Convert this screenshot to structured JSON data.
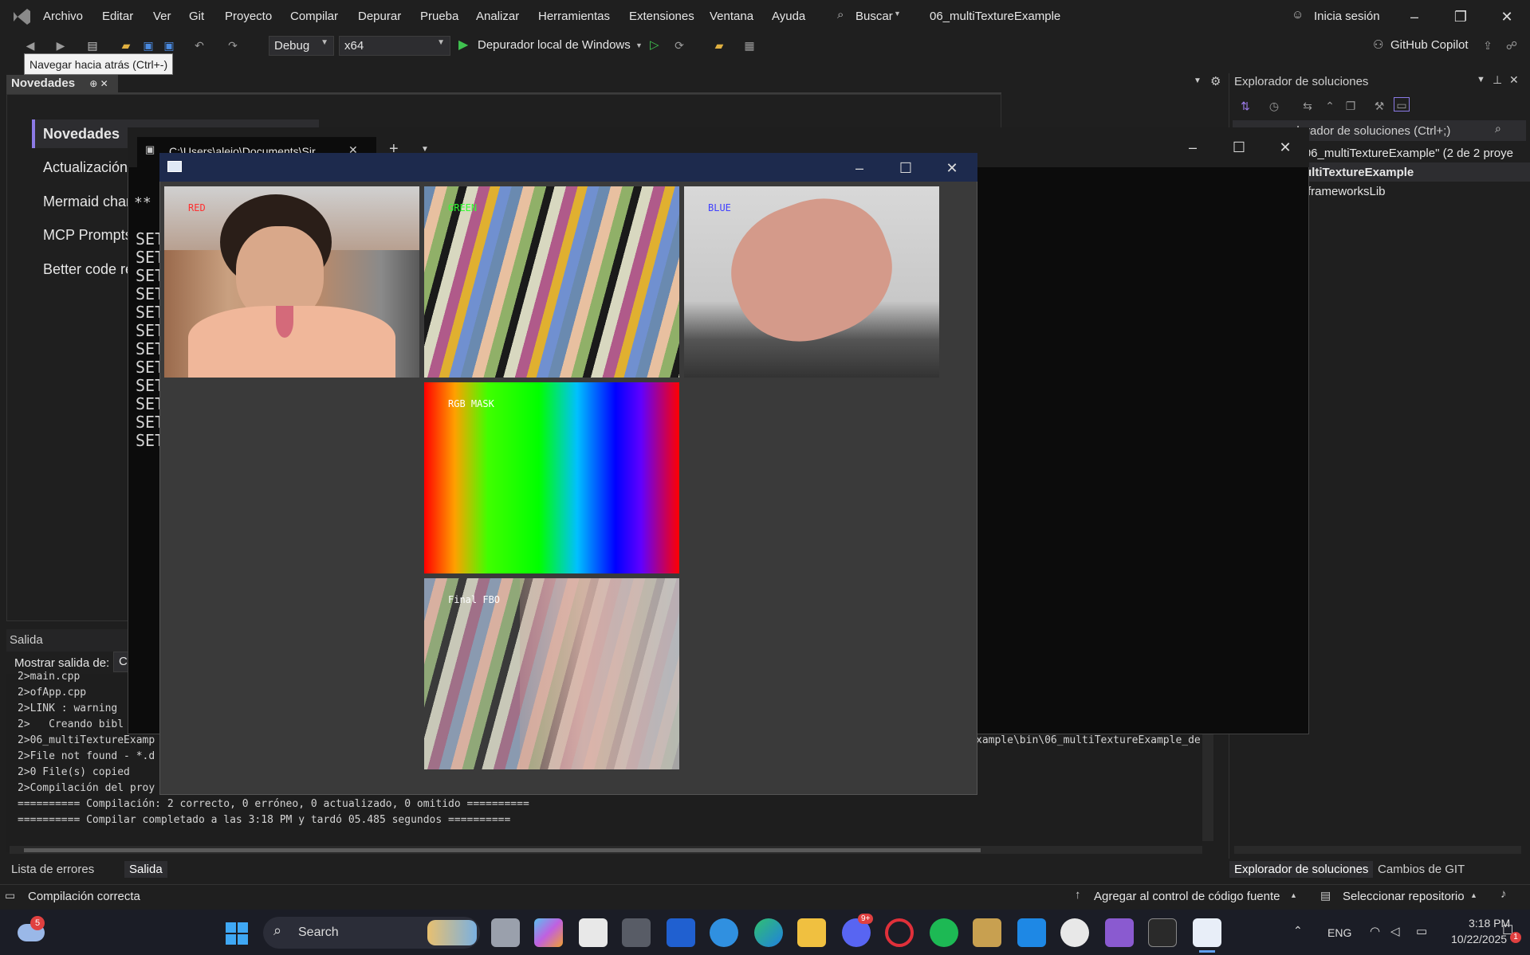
{
  "menubar": {
    "items": [
      "Archivo",
      "Editar",
      "Ver",
      "Git",
      "Proyecto",
      "Compilar",
      "Depurar",
      "Prueba",
      "Analizar",
      "Herramientas",
      "Extensiones",
      "Ventana",
      "Ayuda"
    ],
    "search_label": "Buscar",
    "solution_title": "06_multiTextureExample",
    "signin_label": "Inicia sesión"
  },
  "toolbar": {
    "config": "Debug",
    "platform": "x64",
    "run_label": "Depurador local de Windows",
    "copilot_label": "GitHub Copilot",
    "tooltip": "Navegar hacia atrás (Ctrl+-)"
  },
  "doc": {
    "tab_label": "Novedades",
    "news_items": [
      "Novedades",
      "Actualización",
      "Mermaid char",
      "MCP Prompts",
      "Better code re"
    ]
  },
  "output": {
    "title": "Salida",
    "show_from_label": "Mostrar salida de:",
    "show_from_value": "C",
    "lines": [
      "2>main.cpp",
      "2>ofApp.cpp",
      "2>LINK : warning",
      "2>   Creando bibl",
      "2>06_multiTextureExamp",
      "2>File not found - *.d",
      "2>0 File(s) copied",
      "2>Compilación del proy",
      "========== Compilación: 2 correcto, 0 erróneo, 0 actualizado, 0 omitido ==========",
      "========== Compilar completado a las 3:18 PM y tardó 05.485 segundos =========="
    ],
    "right_path": "xample\\bin\\06_multiTextureExample_de"
  },
  "bottom_tabs": [
    "Lista de errores",
    "Salida"
  ],
  "solution_explorer": {
    "title": "Explorador de soluciones",
    "search_placeholder": "plorador de soluciones (Ctrl+;)",
    "solution_line": "n \"06_multiTextureExample\"  (2 de 2 proye",
    "project": "ultiTextureExample",
    "lib": "frameworksLib",
    "tabs": [
      "Explorador de soluciones",
      "Cambios de GIT"
    ]
  },
  "console": {
    "tab_title": "C:\\Users\\alejo\\Documents\\Sir",
    "prefix": "**",
    "set_lines": [
      "SET",
      "SET",
      "SET",
      "SET",
      "SET",
      "SET",
      "SET",
      "SET",
      "SET",
      "SET",
      "SET",
      "SET"
    ]
  },
  "ofapp": {
    "labels": {
      "red": "RED",
      "green": "GREEN",
      "blue": "BLUE",
      "mask": "RGB MASK",
      "final": "Final FBO"
    },
    "label_colors": {
      "red": "#ff3030",
      "green": "#30ff30",
      "blue": "#4040ff",
      "white": "#ffffff"
    }
  },
  "status": {
    "build": "Compilación correcta",
    "source_control": "Agregar al control de código fuente",
    "repo": "Seleccionar repositorio"
  },
  "taskbar": {
    "search": "Search",
    "lang": "ENG",
    "time": "3:18 PM",
    "date": "10/22/2025",
    "weather_badge": "5",
    "discord_badge": "9+",
    "notif_badge": "1"
  }
}
